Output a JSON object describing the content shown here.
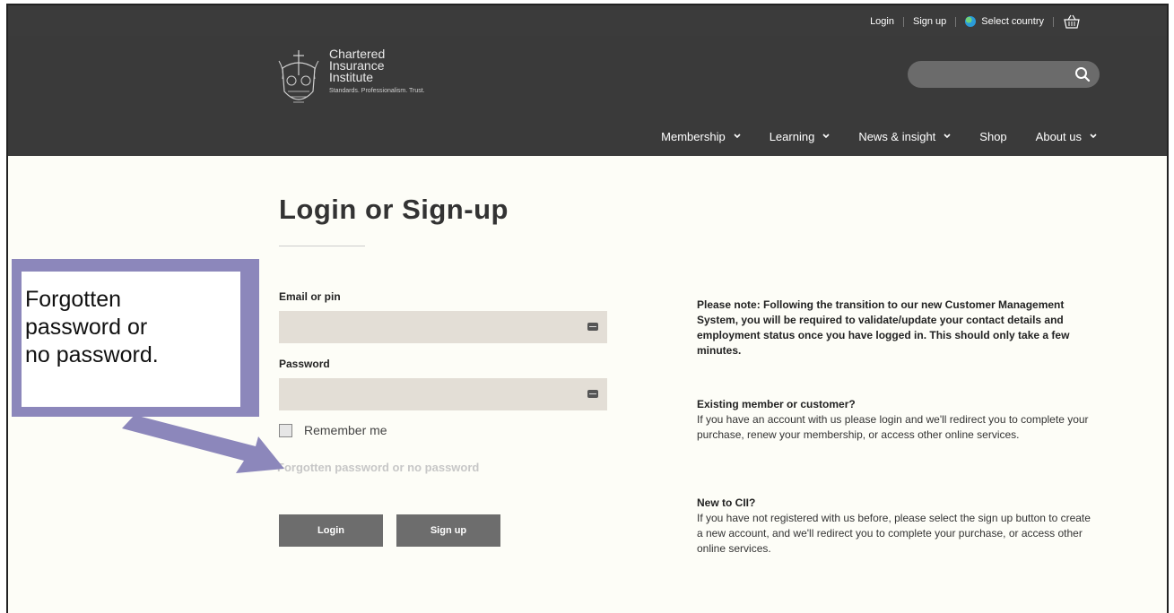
{
  "topbar": {
    "login": "Login",
    "signup": "Sign up",
    "select_country": "Select country"
  },
  "logo": {
    "line1": "Chartered",
    "line2": "Insurance",
    "line3": "Institute",
    "tagline": "Standards. Professionalism. Trust."
  },
  "search": {
    "placeholder": ""
  },
  "nav": {
    "membership": "Membership",
    "learning": "Learning",
    "news": "News & insight",
    "shop": "Shop",
    "about": "About us"
  },
  "page": {
    "title": "Login or Sign-up",
    "email_label": "Email or pin",
    "password_label": "Password",
    "remember_label": "Remember me",
    "forgot_link": "Forgotten password or no password",
    "login_button": "Login",
    "signup_button": "Sign up"
  },
  "info": {
    "note": "Please note: Following the transition to our new Customer Management System, you will be required to validate/update your contact details and employment status once you have logged in. This should only take a few minutes.",
    "existing_heading": "Existing member or customer?",
    "existing_body": "If you have an account with us please login and we'll redirect you to complete your purchase, renew your membership, or access other online services.",
    "new_heading": "New to CII?",
    "new_body": "If you have not registered with us before, please select the sign up button to create a new account, and we'll redirect you to complete your purchase, or access other online services."
  },
  "callout": {
    "line1": "Forgotten",
    "line2": "password or",
    "line3": "no password."
  },
  "colors": {
    "header_bg": "#3a3a3a",
    "field_bg": "#e3ded6",
    "button_bg": "#6d6d6d",
    "callout_border": "#8c87bb"
  }
}
